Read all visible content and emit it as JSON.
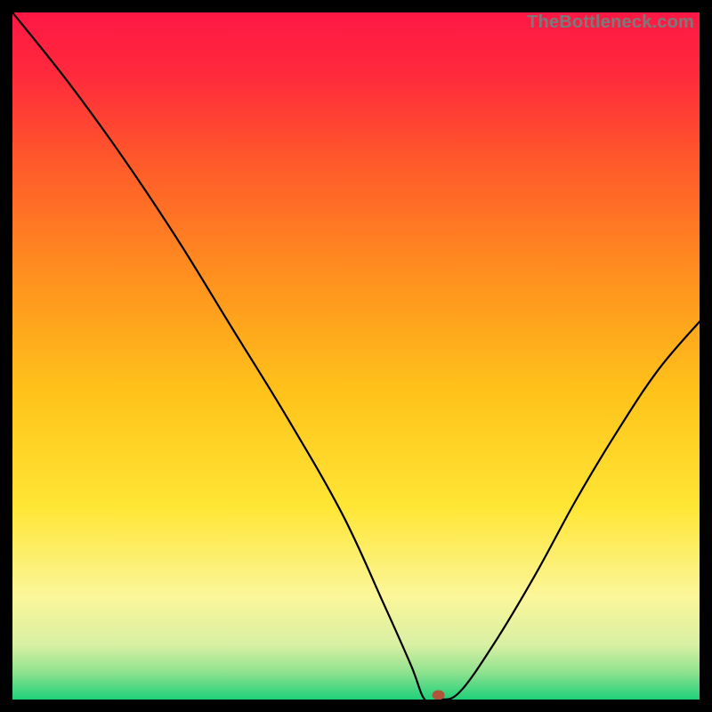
{
  "watermark": "TheBottleneck.com",
  "chart_data": {
    "type": "line",
    "title": "",
    "xlabel": "",
    "ylabel": "",
    "xlim": [
      0,
      100
    ],
    "ylim": [
      0,
      100
    ],
    "grid": false,
    "legend": false,
    "background": "red-yellow-green vertical gradient",
    "series": [
      {
        "name": "bottleneck-curve",
        "x": [
          0,
          8,
          16,
          24,
          32,
          40,
          48,
          54,
          58,
          60,
          62,
          65,
          70,
          76,
          82,
          88,
          94,
          100
        ],
        "y": [
          100,
          90,
          79,
          67,
          54,
          41,
          27,
          14,
          5,
          0,
          0,
          1,
          8,
          18,
          29,
          39,
          48,
          55
        ]
      }
    ],
    "marker": {
      "x": 62,
      "y": 0,
      "color": "#b0543a"
    },
    "gradient_stops": [
      {
        "offset": 0.0,
        "color": "#ff1744"
      },
      {
        "offset": 0.09,
        "color": "#ff2a3c"
      },
      {
        "offset": 0.22,
        "color": "#ff5a2a"
      },
      {
        "offset": 0.38,
        "color": "#ff8f1f"
      },
      {
        "offset": 0.55,
        "color": "#ffc21a"
      },
      {
        "offset": 0.72,
        "color": "#ffe635"
      },
      {
        "offset": 0.85,
        "color": "#fbf69a"
      },
      {
        "offset": 0.92,
        "color": "#d9f0a3"
      },
      {
        "offset": 0.96,
        "color": "#8fe28f"
      },
      {
        "offset": 1.0,
        "color": "#1fd07a"
      }
    ]
  }
}
